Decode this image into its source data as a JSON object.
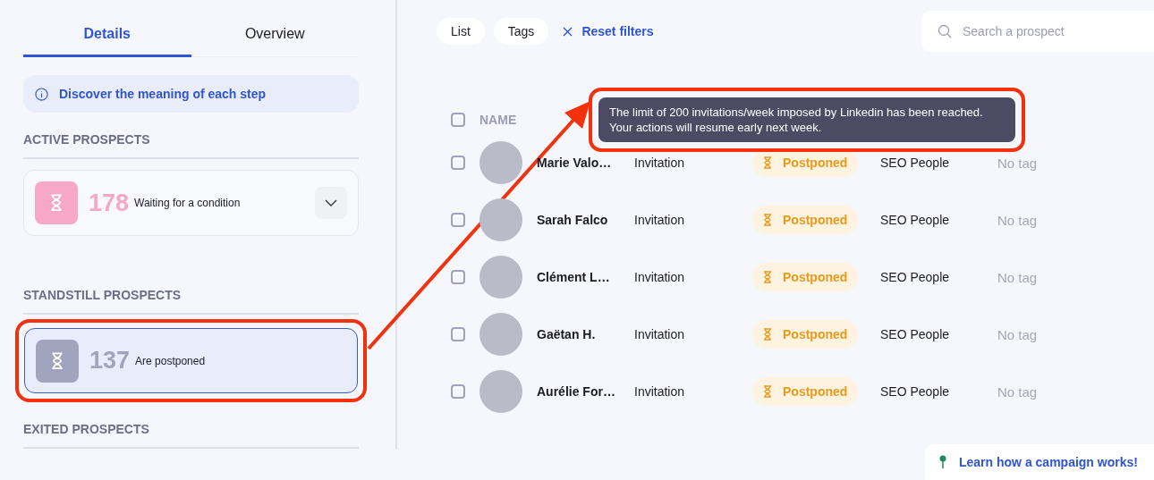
{
  "tabs": [
    {
      "label": "Details",
      "selected": true
    },
    {
      "label": "Overview",
      "selected": false
    }
  ],
  "info_banner": {
    "text": "Discover the meaning of each step"
  },
  "sections": [
    {
      "title": "ACTIVE PROSPECTS",
      "cards": [
        {
          "count": "178",
          "label": "Waiting for a condition",
          "color": "#f7a8c8",
          "expandable": true,
          "selected": false,
          "highlighted": false
        }
      ]
    },
    {
      "title": "STANDSTILL PROSPECTS",
      "cards": [
        {
          "count": "137",
          "label": "Are postponed",
          "color": "#a1a4bd",
          "expandable": false,
          "selected": true,
          "highlighted": true
        }
      ]
    },
    {
      "title": "EXITED PROSPECTS"
    }
  ],
  "filters": [
    {
      "label": "List"
    },
    {
      "label": "Tags"
    }
  ],
  "reset_filters": "Reset filters",
  "search": {
    "placeholder": "Search a prospect"
  },
  "table": {
    "select_all": {
      "checked": false
    },
    "columns": [
      "NAME"
    ],
    "rows": [
      {
        "checked": false,
        "name": "Marie Valo…",
        "step": "Invitation",
        "status": "Postponed",
        "campaign": "SEO People",
        "tag": "No tag"
      },
      {
        "checked": false,
        "name": "Sarah Falco",
        "step": "Invitation",
        "status": "Postponed",
        "campaign": "SEO People",
        "tag": "No tag"
      },
      {
        "checked": false,
        "name": "Clément L…",
        "step": "Invitation",
        "status": "Postponed",
        "campaign": "SEO People",
        "tag": "No tag"
      },
      {
        "checked": false,
        "name": "Gaëtan H.",
        "step": "Invitation",
        "status": "Postponed",
        "campaign": "SEO People",
        "tag": "No tag"
      },
      {
        "checked": false,
        "name": "Aurélie For…",
        "step": "Invitation",
        "status": "Postponed",
        "campaign": "SEO People",
        "tag": "No tag"
      }
    ]
  },
  "tooltip": {
    "text": "The limit of 200 invitations/week imposed by Linkedin has been reached. Your actions will resume early next week.",
    "highlighted": true
  },
  "help_button": {
    "label": "Learn how a campaign works!"
  }
}
